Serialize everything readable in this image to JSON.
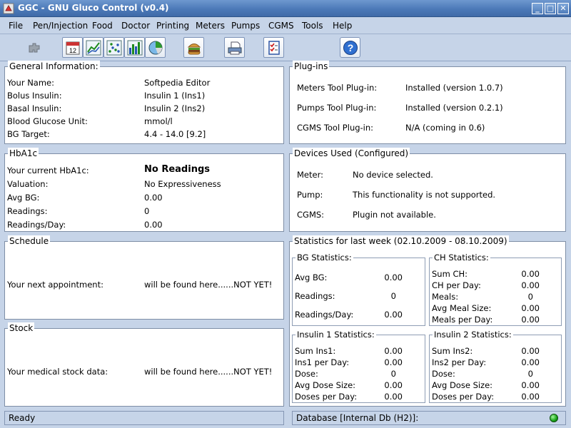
{
  "window": {
    "title": "GGC - GNU Gluco Control (v0.4)"
  },
  "menu": [
    "File",
    "Pen/Injection",
    "Food",
    "Doctor",
    "Printing",
    "Meters",
    "Pumps",
    "CGMS",
    "Tools",
    "Help"
  ],
  "general": {
    "title": "General Information:",
    "rows": [
      {
        "label": "Your Name:",
        "value": "Softpedia Editor"
      },
      {
        "label": "Bolus Insulin:",
        "value": "Insulin 1  (Ins1)"
      },
      {
        "label": "Basal Insulin:",
        "value": "Insulin 2  (Ins2)"
      },
      {
        "label": "Blood Glucose Unit:",
        "value": "mmol/l"
      },
      {
        "label": "BG Target:",
        "value": "4.4 - 14.0 [9.2]"
      }
    ]
  },
  "plugins": {
    "title": "Plug-ins",
    "rows": [
      {
        "label": "Meters Tool Plug-in:",
        "value": "Installed (version 1.0.7)"
      },
      {
        "label": "Pumps Tool Plug-in:",
        "value": "Installed (version 0.2.1)"
      },
      {
        "label": "CGMS Tool Plug-in:",
        "value": "N/A (coming in 0.6)"
      }
    ]
  },
  "hba1c": {
    "title": "HbA1c",
    "rows": [
      {
        "label": "Your current HbA1c:",
        "value": "No Readings"
      },
      {
        "label": "Valuation:",
        "value": "No Expressiveness"
      },
      {
        "label": "Avg BG:",
        "value": "0.00"
      },
      {
        "label": "Readings:",
        "value": "0"
      },
      {
        "label": "Readings/Day:",
        "value": "0.00"
      }
    ]
  },
  "devices": {
    "title": "Devices Used (Configured)",
    "rows": [
      {
        "label": "Meter:",
        "value": "No device selected."
      },
      {
        "label": "Pump:",
        "value": "This functionality is not supported."
      },
      {
        "label": "CGMS:",
        "value": "Plugin not available."
      }
    ]
  },
  "schedule": {
    "title": "Schedule",
    "label": "Your next appointment:",
    "value": "will be found here......NOT YET!"
  },
  "stock": {
    "title": "Stock",
    "label": "Your medical stock data:",
    "value": "will be found here......NOT YET!"
  },
  "stats": {
    "title": "Statistics for last week (02.10.2009 - 08.10.2009)",
    "bg": {
      "title": "BG Statistics:",
      "rows": [
        {
          "label": "Avg BG:",
          "value": "0.00"
        },
        {
          "label": "Readings:",
          "value": "0"
        },
        {
          "label": "Readings/Day:",
          "value": "0.00"
        }
      ]
    },
    "ch": {
      "title": "CH Statistics:",
      "rows": [
        {
          "label": "Sum CH:",
          "value": "0.00"
        },
        {
          "label": "CH per Day:",
          "value": "0.00"
        },
        {
          "label": "Meals:",
          "value": "0"
        },
        {
          "label": "Avg Meal Size:",
          "value": "0.00"
        },
        {
          "label": "Meals per Day:",
          "value": "0.00"
        }
      ]
    },
    "ins1": {
      "title": "Insulin 1 Statistics:",
      "rows": [
        {
          "label": "Sum Ins1:",
          "value": "0.00"
        },
        {
          "label": "Ins1 per Day:",
          "value": "0.00"
        },
        {
          "label": "Dose:",
          "value": "0"
        },
        {
          "label": "Avg Dose Size:",
          "value": "0.00"
        },
        {
          "label": "Doses per Day:",
          "value": "0.00"
        }
      ]
    },
    "ins2": {
      "title": "Insulin 2 Statistics:",
      "rows": [
        {
          "label": "Sum Ins2:",
          "value": "0.00"
        },
        {
          "label": "Ins2 per Day:",
          "value": "0.00"
        },
        {
          "label": "Dose:",
          "value": "0"
        },
        {
          "label": "Avg Dose Size:",
          "value": "0.00"
        },
        {
          "label": "Doses per Day:",
          "value": "0.00"
        }
      ]
    }
  },
  "status": {
    "left": "Ready",
    "right": "Database [Internal Db (H2)]:",
    "db_indicator_color": "#17a316"
  },
  "toolbar_icons": [
    "plugin-icon",
    "calendar-icon",
    "line-graph-icon",
    "scatter-graph-icon",
    "bar-graph-icon",
    "pie-chart-icon",
    "food-icon",
    "printer-icon",
    "checklist-icon",
    "help-icon"
  ]
}
